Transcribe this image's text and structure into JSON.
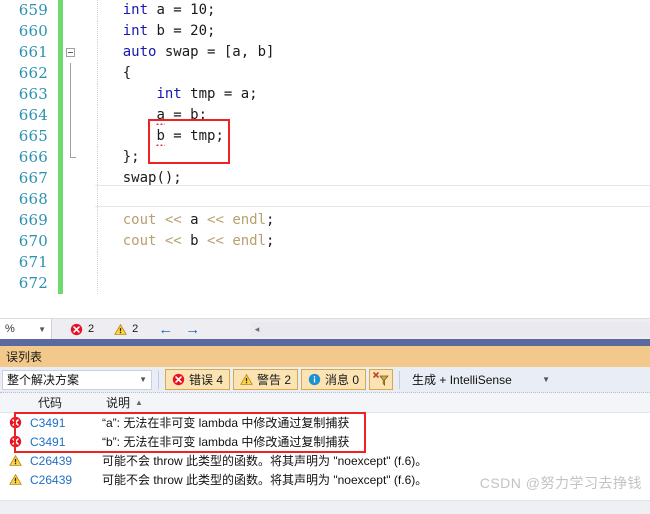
{
  "editor": {
    "first_line_number": 659,
    "lines": [
      {
        "num": "659",
        "indent": 4,
        "tokens": [
          {
            "t": "int",
            "c": "k"
          },
          {
            "t": " a = ",
            "c": "t"
          },
          {
            "t": "10",
            "c": "n"
          },
          {
            "t": ";",
            "c": "t"
          }
        ]
      },
      {
        "num": "660",
        "indent": 4,
        "tokens": [
          {
            "t": "int",
            "c": "k"
          },
          {
            "t": " b = ",
            "c": "t"
          },
          {
            "t": "20",
            "c": "n"
          },
          {
            "t": ";",
            "c": "t"
          }
        ]
      },
      {
        "num": "661",
        "indent": 4,
        "marker": "collapse-box",
        "tokens": [
          {
            "t": "auto",
            "c": "k"
          },
          {
            "t": " swap = [a, b]",
            "c": "t"
          }
        ]
      },
      {
        "num": "662",
        "indent": 4,
        "marker": "collapse-line",
        "tokens": [
          {
            "t": "{",
            "c": "t"
          }
        ]
      },
      {
        "num": "663",
        "indent": 8,
        "marker": "collapse-line",
        "tokens": [
          {
            "t": "int",
            "c": "k"
          },
          {
            "t": " tmp = a;",
            "c": "t"
          }
        ]
      },
      {
        "num": "664",
        "indent": 8,
        "marker": "collapse-line",
        "tokens": [
          {
            "t": "a",
            "c": "t sq"
          },
          {
            "t": " = b;",
            "c": "t"
          }
        ]
      },
      {
        "num": "665",
        "indent": 8,
        "marker": "collapse-line",
        "tokens": [
          {
            "t": "b",
            "c": "t sq"
          },
          {
            "t": " = tmp;",
            "c": "t"
          }
        ]
      },
      {
        "num": "666",
        "indent": 4,
        "marker": "collapse-end",
        "tokens": [
          {
            "t": "};",
            "c": "t"
          }
        ]
      },
      {
        "num": "667",
        "indent": 4,
        "tokens": [
          {
            "t": "swap",
            "c": "t"
          },
          {
            "t": "();",
            "c": "t"
          }
        ]
      },
      {
        "num": "668",
        "indent": 4,
        "tokens": []
      },
      {
        "num": "669",
        "indent": 4,
        "tokens": [
          {
            "t": "cout",
            "c": "obj"
          },
          {
            "t": " << ",
            "c": "op"
          },
          {
            "t": "a",
            "c": "t"
          },
          {
            "t": " << ",
            "c": "op"
          },
          {
            "t": "endl",
            "c": "obj"
          },
          {
            "t": ";",
            "c": "t"
          }
        ]
      },
      {
        "num": "670",
        "indent": 4,
        "tokens": [
          {
            "t": "cout",
            "c": "obj"
          },
          {
            "t": " << ",
            "c": "op"
          },
          {
            "t": "b",
            "c": "t"
          },
          {
            "t": " << ",
            "c": "op"
          },
          {
            "t": "endl",
            "c": "obj"
          },
          {
            "t": ";",
            "c": "t"
          }
        ]
      },
      {
        "num": "671",
        "indent": 4,
        "tokens": []
      },
      {
        "num": "672",
        "indent": 4,
        "tokens": []
      }
    ]
  },
  "statusbar": {
    "zoom_label": "%",
    "error_count": "2",
    "warning_count": "2",
    "prev_arrow": "←",
    "next_arrow": "→",
    "scroll_left_arrow": "◂"
  },
  "panel": {
    "tab_label": "误列表",
    "toolbar": {
      "scope_value": "整个解决方案",
      "errors_label": "错误 4",
      "warnings_label": "警告 2",
      "messages_label": "消息 0",
      "clear_filter_label": "",
      "build_filter_value": "生成 + IntelliSense"
    },
    "columns": {
      "code": "代码",
      "description": "说明",
      "sort_arrow": "▲"
    },
    "rows": [
      {
        "severity": "error",
        "code": "C3491",
        "description": "“a”: 无法在非可变 lambda 中修改通过复制捕获"
      },
      {
        "severity": "error",
        "code": "C3491",
        "description": "“b”: 无法在非可变 lambda 中修改通过复制捕获"
      },
      {
        "severity": "warning",
        "code": "C26439",
        "description": "可能不会 throw 此类型的函数。将其声明为 \"noexcept\" (f.6)。"
      },
      {
        "severity": "warning",
        "code": "C26439",
        "description": "可能不会 throw 此类型的函数。将其声明为 \"noexcept\" (f.6)。"
      }
    ],
    "watermark": "CSDN @努力学习去挣钱"
  },
  "colors": {
    "keyword_blue": "#1717b8",
    "line_number_blue": "#2b91af",
    "object_tan": "#b8a070",
    "change_bar_green": "#6ed96e",
    "highlight_red": "#ee2222",
    "panel_tab_gold": "#f2c98a",
    "panel_title_blue": "#5b6a9e",
    "code_link_blue": "#1f6fc4"
  }
}
